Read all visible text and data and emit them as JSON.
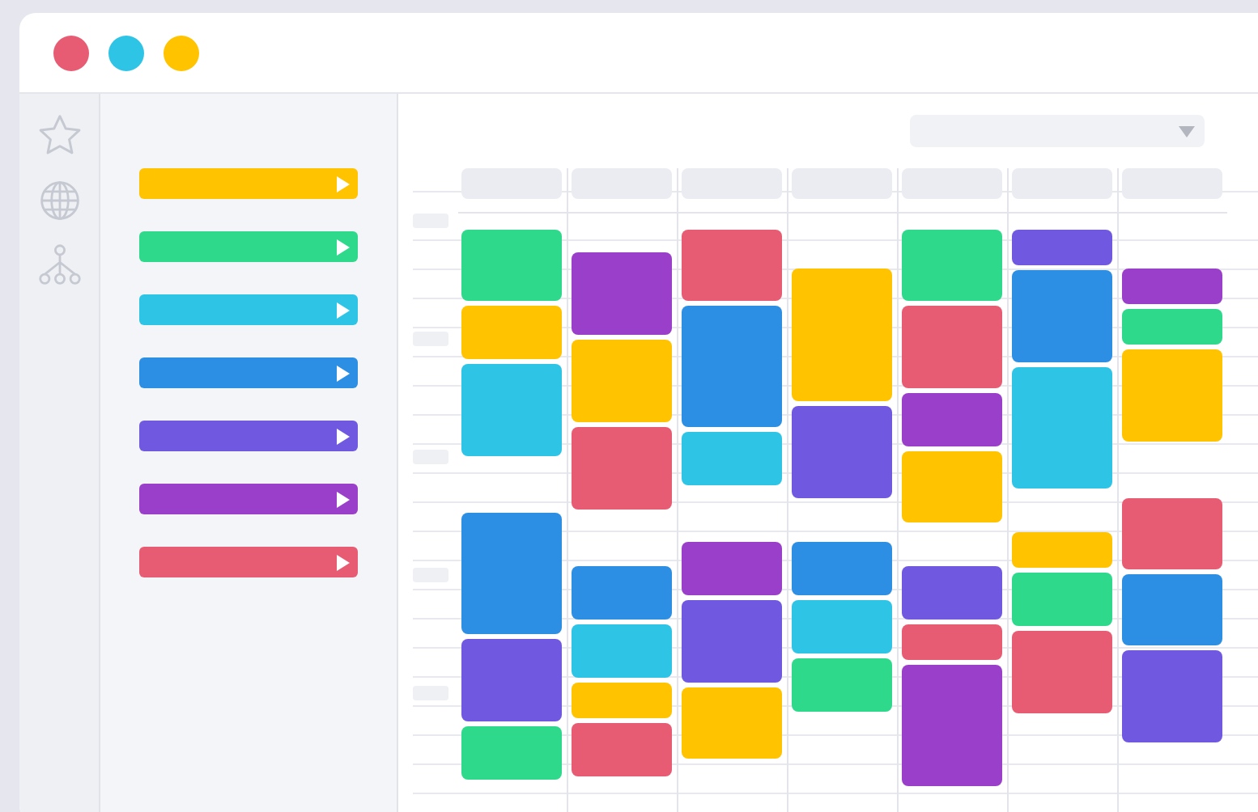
{
  "categories": [
    {
      "color": "#ffc300"
    },
    {
      "color": "#2ed98c"
    },
    {
      "color": "#2ec4e6"
    },
    {
      "color": "#2d8fe3"
    },
    {
      "color": "#7059e0"
    },
    {
      "color": "#9a3fc9"
    },
    {
      "color": "#e85c73"
    }
  ],
  "columns": [
    {
      "events": [
        {
          "kind": "m",
          "color": "#2ed98c"
        },
        {
          "kind": "s",
          "color": "#ffc300"
        },
        {
          "kind": "l",
          "color": "#2ec4e6"
        },
        {
          "kind": "pad-l"
        },
        {
          "kind": "xl",
          "color": "#2d8fe3"
        },
        {
          "kind": "ml",
          "color": "#7059e0"
        },
        {
          "kind": "s",
          "color": "#2ed98c"
        }
      ]
    },
    {
      "events": [
        {
          "kind": "pad-s"
        },
        {
          "kind": "ml",
          "color": "#9a3fc9"
        },
        {
          "kind": "ml",
          "color": "#ffc300"
        },
        {
          "kind": "ml",
          "color": "#e85c73"
        },
        {
          "kind": "pad-l"
        },
        {
          "kind": "s",
          "color": "#2d8fe3"
        },
        {
          "kind": "s",
          "color": "#2ec4e6"
        },
        {
          "kind": "xs",
          "color": "#ffc300"
        },
        {
          "kind": "s",
          "color": "#e85c73"
        }
      ]
    },
    {
      "events": [
        {
          "kind": "m",
          "color": "#e85c73"
        },
        {
          "kind": "xl",
          "color": "#2d8fe3"
        },
        {
          "kind": "s",
          "color": "#2ec4e6"
        },
        {
          "kind": "pad-l"
        },
        {
          "kind": "s",
          "color": "#9a3fc9"
        },
        {
          "kind": "ml",
          "color": "#7059e0"
        },
        {
          "kind": "m",
          "color": "#ffc300"
        }
      ]
    },
    {
      "events": [
        {
          "kind": "pad-m"
        },
        {
          "kind": "xxl",
          "color": "#ffc300"
        },
        {
          "kind": "l",
          "color": "#7059e0"
        },
        {
          "kind": "pad-m"
        },
        {
          "kind": "s",
          "color": "#2d8fe3"
        },
        {
          "kind": "s",
          "color": "#2ec4e6"
        },
        {
          "kind": "s",
          "color": "#2ed98c"
        }
      ]
    },
    {
      "events": [
        {
          "kind": "m",
          "color": "#2ed98c"
        },
        {
          "kind": "ml",
          "color": "#e85c73"
        },
        {
          "kind": "s",
          "color": "#9a3fc9"
        },
        {
          "kind": "m",
          "color": "#ffc300"
        },
        {
          "kind": "pad-m"
        },
        {
          "kind": "s",
          "color": "#7059e0"
        },
        {
          "kind": "xs",
          "color": "#e85c73"
        },
        {
          "kind": "xl",
          "color": "#9a3fc9"
        }
      ]
    },
    {
      "events": [
        {
          "kind": "xs",
          "color": "#7059e0"
        },
        {
          "kind": "l",
          "color": "#2d8fe3"
        },
        {
          "kind": "xl",
          "color": "#2ec4e6"
        },
        {
          "kind": "pad-m"
        },
        {
          "kind": "xs",
          "color": "#ffc300"
        },
        {
          "kind": "s",
          "color": "#2ed98c"
        },
        {
          "kind": "ml",
          "color": "#e85c73"
        }
      ]
    },
    {
      "events": [
        {
          "kind": "pad-m"
        },
        {
          "kind": "xs",
          "color": "#9a3fc9"
        },
        {
          "kind": "xs",
          "color": "#2ed98c"
        },
        {
          "kind": "l",
          "color": "#ffc300"
        },
        {
          "kind": "pad-l"
        },
        {
          "kind": "m",
          "color": "#e85c73"
        },
        {
          "kind": "m",
          "color": "#2d8fe3"
        },
        {
          "kind": "l",
          "color": "#7059e0"
        }
      ]
    }
  ]
}
